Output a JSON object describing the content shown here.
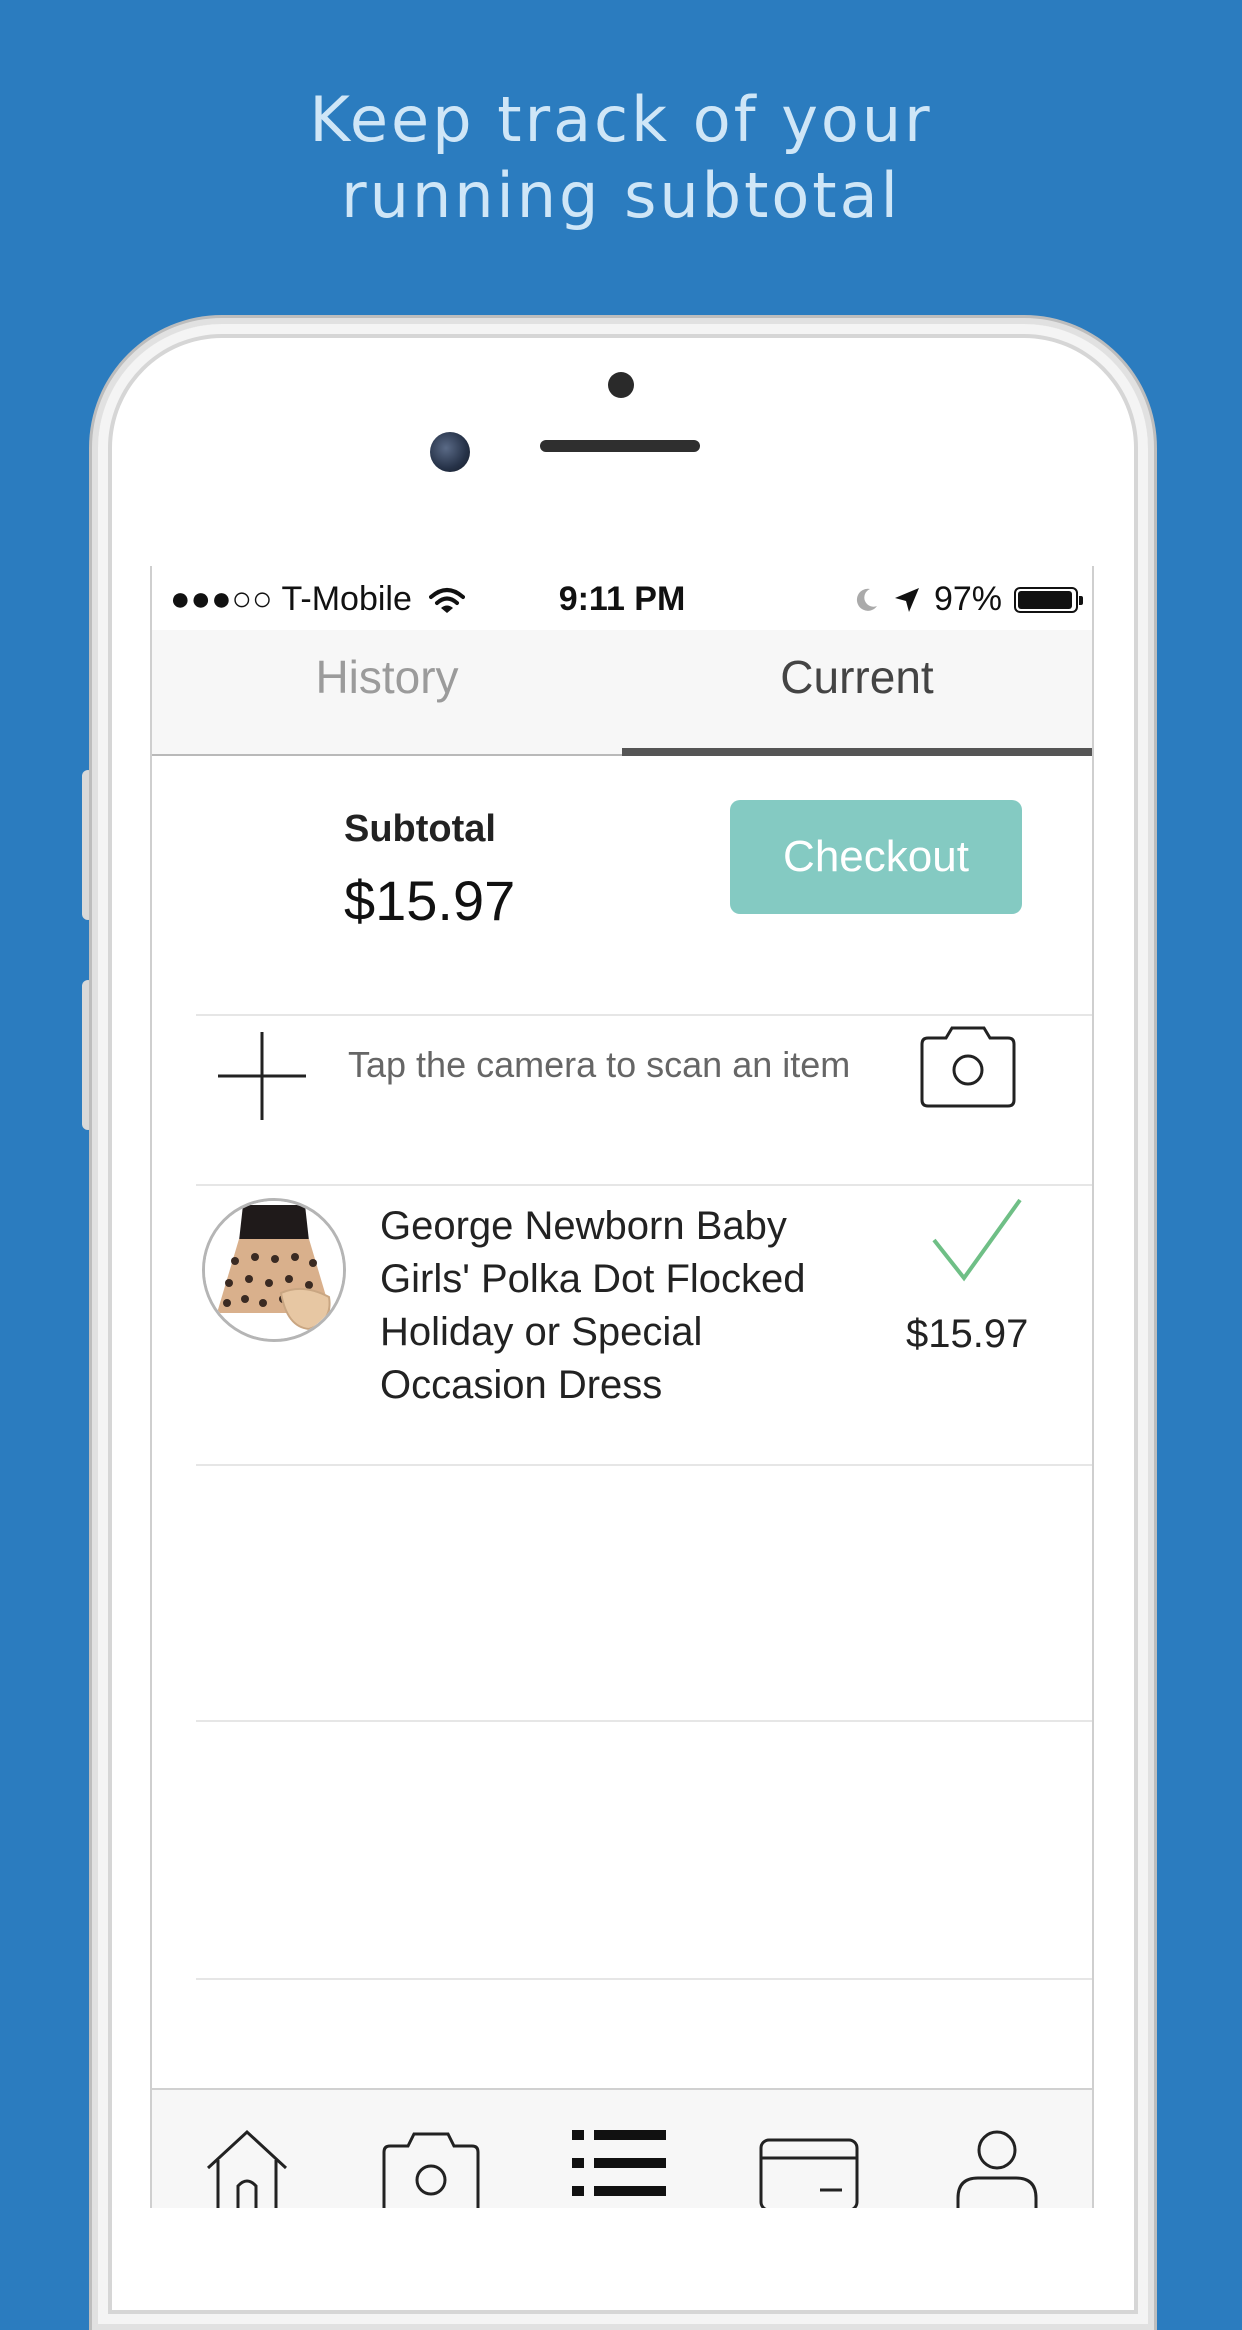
{
  "headline": {
    "line1": "Keep track of your",
    "line2": "running subtotal"
  },
  "status_bar": {
    "carrier": "●●●○○ T-Mobile",
    "time": "9:11 PM",
    "battery": "97%",
    "battery_level": 0.97,
    "icons": [
      "signal-icon",
      "wifi-icon",
      "moon-icon",
      "location-arrow-icon",
      "battery-icon"
    ]
  },
  "tabs": [
    {
      "label": "History",
      "active": false
    },
    {
      "label": "Current",
      "active": true
    }
  ],
  "subtotal": {
    "label": "Subtotal",
    "value": "$15.97"
  },
  "checkout": {
    "label": "Checkout",
    "color": "#84cac2"
  },
  "scan": {
    "hint": "Tap the camera to scan an item",
    "icons": [
      "plus-icon",
      "camera-icon"
    ]
  },
  "items": [
    {
      "name": "George Newborn Baby Girls' Polka Dot Flocked Holiday or Special Occasion Dress",
      "price": "$15.97",
      "checked": true,
      "check_color": "#6fbf86"
    }
  ],
  "bottom_nav": {
    "icons": [
      "home-icon",
      "camera-icon",
      "list-icon",
      "card-icon",
      "profile-icon"
    ]
  },
  "colors": {
    "background": "#2b7cbf",
    "headline": "#cfe6f7"
  }
}
